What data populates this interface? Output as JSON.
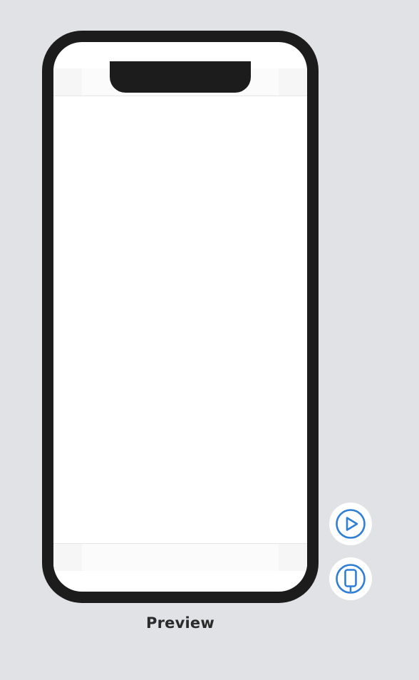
{
  "preview": {
    "label": "Preview"
  },
  "controls": {
    "play_icon": "play-circle-icon",
    "device_icon": "device-rotate-icon",
    "accent_color": "#2f7fd6"
  },
  "colors": {
    "background": "#e1e2e6",
    "device_frame": "#1c1c1c",
    "screen": "#ffffff"
  }
}
